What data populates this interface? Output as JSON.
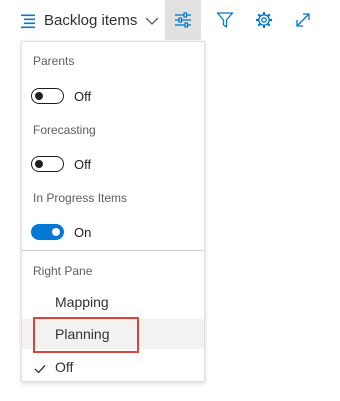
{
  "toolbar": {
    "view_picker_label": "Backlog items",
    "icons": [
      "backlog-list-icon",
      "chevron-down-icon",
      "view-options-icon",
      "filter-icon",
      "gear-icon",
      "expand-icon"
    ]
  },
  "panel": {
    "parents": {
      "label": "Parents",
      "state": "Off",
      "on": false
    },
    "forecasting": {
      "label": "Forecasting",
      "state": "Off",
      "on": false
    },
    "in_progress": {
      "label": "In Progress Items",
      "state": "On",
      "on": true
    },
    "right_pane": {
      "label": "Right Pane",
      "options": [
        "Mapping",
        "Planning",
        "Off"
      ],
      "selected": "Off",
      "highlighted": "Planning"
    }
  },
  "colors": {
    "accent": "#0078d4",
    "highlight_border": "#d9453b",
    "active_button_bg": "#e1e1e1"
  }
}
